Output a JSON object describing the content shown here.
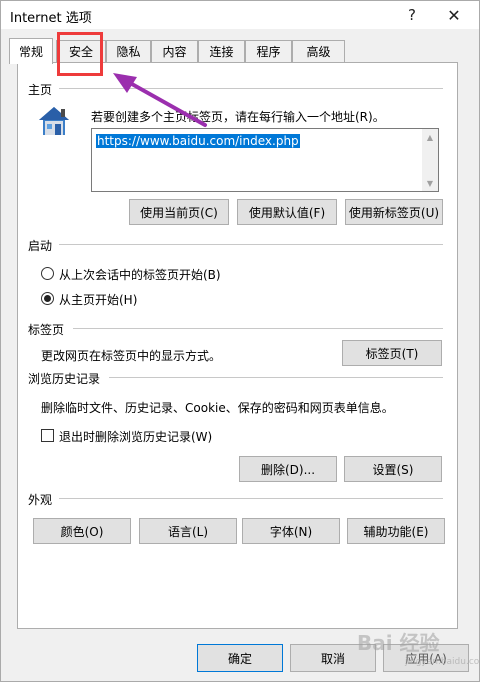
{
  "window": {
    "title": "Internet 选项",
    "help": "?",
    "close": "✕"
  },
  "tabs": [
    {
      "label": "常规",
      "active": true
    },
    {
      "label": "安全"
    },
    {
      "label": "隐私"
    },
    {
      "label": "内容"
    },
    {
      "label": "连接"
    },
    {
      "label": "程序"
    },
    {
      "label": "高级"
    }
  ],
  "homepage": {
    "section_title": "主页",
    "instruction": "若要创建多个主页标签页，请在每行输入一个地址(R)。",
    "url_value": "https://www.baidu.com/index.php",
    "btn_current": "使用当前页(C)",
    "btn_default": "使用默认值(F)",
    "btn_newtab": "使用新标签页(U)"
  },
  "startup": {
    "section_title": "启动",
    "option_last_session": "从上次会话中的标签页开始(B)",
    "option_homepage": "从主页开始(H)"
  },
  "tabs_section": {
    "section_title": "标签页",
    "description": "更改网页在标签页中的显示方式。",
    "button": "标签页(T)"
  },
  "history": {
    "section_title": "浏览历史记录",
    "description": "删除临时文件、历史记录、Cookie、保存的密码和网页表单信息。",
    "checkbox_label": "退出时删除浏览历史记录(W)",
    "btn_delete": "删除(D)...",
    "btn_settings": "设置(S)"
  },
  "appearance": {
    "section_title": "外观",
    "btn_colors": "颜色(O)",
    "btn_languages": "语言(L)",
    "btn_fonts": "字体(N)",
    "btn_accessibility": "辅助功能(E)"
  },
  "footer": {
    "ok": "确定",
    "cancel": "取消",
    "apply": "应用(A)"
  },
  "watermark": {
    "text": "Bai 经验",
    "sub": "jingyan.baidu.com"
  },
  "colors": {
    "annotation": "#ee3b3b",
    "arrow": "#9b2fae",
    "selection": "#0078d7"
  }
}
